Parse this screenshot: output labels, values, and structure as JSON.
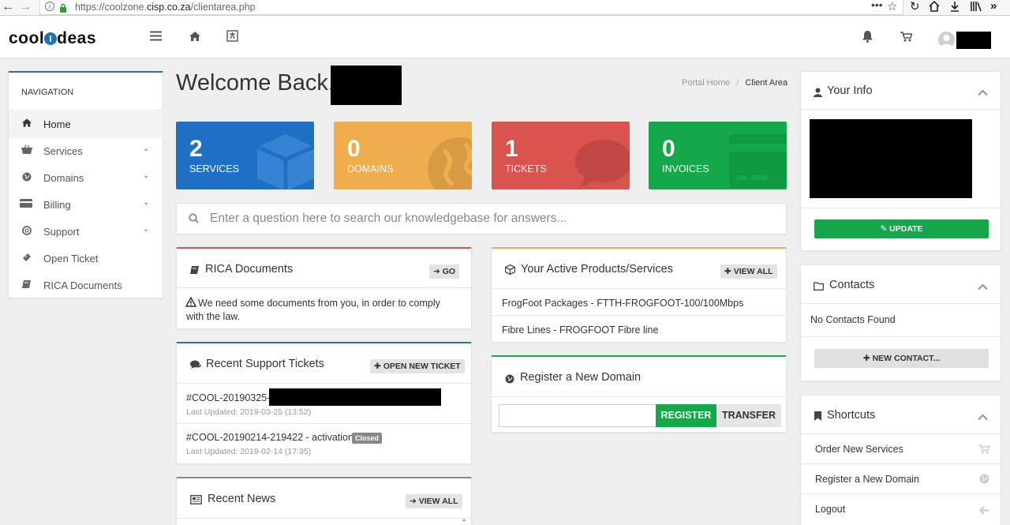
{
  "browser": {
    "url_prefix": "https://coolzone.",
    "url_domain": "cisp.co.za",
    "url_path": "/clientarea.php"
  },
  "header": {
    "logo_left": "cool",
    "logo_right": "deas"
  },
  "page": {
    "welcome": "Welcome Back,",
    "breadcrumb_home": "Portal Home",
    "breadcrumb_sep": "/",
    "breadcrumb_current": "Client Area"
  },
  "nav": {
    "heading": "NAVIGATION",
    "items": [
      {
        "label": "Home",
        "icon": "home-icon"
      },
      {
        "label": "Services",
        "icon": "basket-icon"
      },
      {
        "label": "Domains",
        "icon": "globe-icon"
      },
      {
        "label": "Billing",
        "icon": "credit-card-icon"
      },
      {
        "label": "Support",
        "icon": "lifebuoy-icon"
      },
      {
        "label": "Open Ticket",
        "icon": "ticket-icon"
      },
      {
        "label": "RICA Documents",
        "icon": "book-icon"
      }
    ]
  },
  "stats": [
    {
      "value": "2",
      "label": "SERVICES",
      "color": "#1f6fc4"
    },
    {
      "value": "0",
      "label": "DOMAINS",
      "color": "#f0ad4e"
    },
    {
      "value": "1",
      "label": "TICKETS",
      "color": "#d9534f"
    },
    {
      "value": "0",
      "label": "INVOICES",
      "color": "#14a84a"
    }
  ],
  "search": {
    "placeholder": "Enter a question here to search our knowledgebase for answers..."
  },
  "rica": {
    "title": "RICA Documents",
    "go_label": "GO",
    "message": "We need some documents from you, in order to comply with the law."
  },
  "tickets": {
    "title": "Recent Support Tickets",
    "open_label": "OPEN NEW TICKET",
    "items": [
      {
        "title": "#COOL-20190325-2",
        "updated": "Last Updated: 2019-03-25 (13:52)",
        "status": ""
      },
      {
        "title": "#COOL-20190214-219422 - activation",
        "updated": "Last Updated: 2019-02-14 (17:35)",
        "status": "Closed"
      }
    ]
  },
  "news": {
    "title": "Recent News",
    "view_all": "VIEW ALL"
  },
  "products": {
    "title": "Your Active Products/Services",
    "view_all": "VIEW ALL",
    "items": [
      "FrogFoot Packages - FTTH-FROGFOOT-100/100Mbps",
      "Fibre Lines - FROGFOOT Fibre line"
    ]
  },
  "register_domain": {
    "title": "Register a New Domain",
    "register_label": "REGISTER",
    "transfer_label": "TRANSFER"
  },
  "your_info": {
    "title": "Your Info",
    "update_label": "UPDATE"
  },
  "contacts": {
    "title": "Contacts",
    "empty": "No Contacts Found",
    "new_label": "NEW CONTACT..."
  },
  "shortcuts": {
    "title": "Shortcuts",
    "items": [
      {
        "label": "Order New Services",
        "icon": "cart-icon"
      },
      {
        "label": "Register a New Domain",
        "icon": "globe-icon"
      },
      {
        "label": "Logout",
        "icon": "arrow-left-icon"
      }
    ]
  }
}
